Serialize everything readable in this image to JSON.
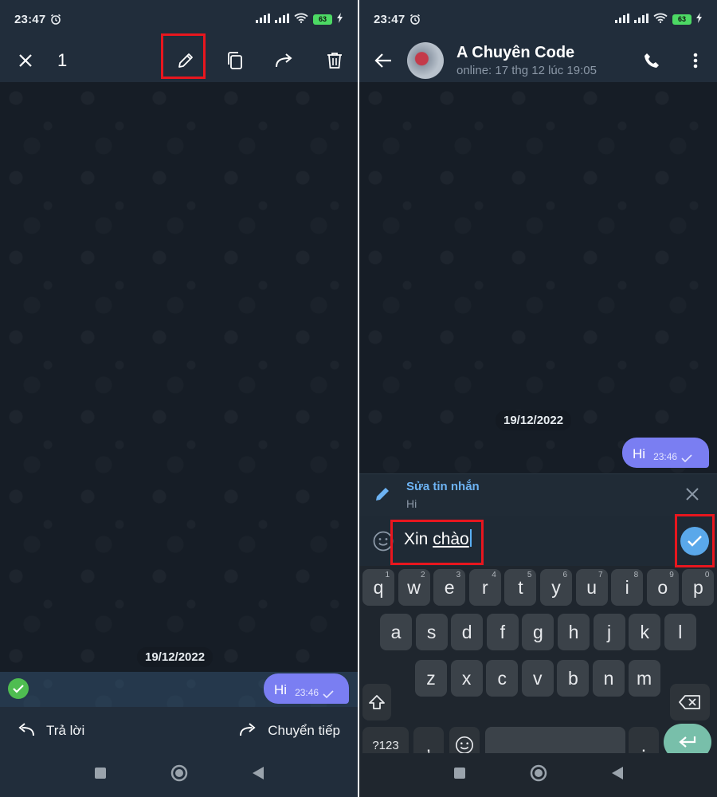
{
  "left": {
    "status": {
      "time": "23:47",
      "battery": "63"
    },
    "topbar": {
      "selected_count": "1"
    },
    "date": "19/12/2022",
    "message": {
      "text": "Hi",
      "time": "23:46"
    },
    "actions": {
      "reply": "Trả lời",
      "forward": "Chuyển tiếp"
    }
  },
  "right": {
    "status": {
      "time": "23:47",
      "battery": "63"
    },
    "header": {
      "name": "A Chuyên Code",
      "status": "online: 17 thg 12 lúc 19:05"
    },
    "date": "19/12/2022",
    "message": {
      "text": "Hi",
      "time": "23:46"
    },
    "edit": {
      "label": "Sửa tin nhắn",
      "original": "Hi"
    },
    "input": {
      "prefix": "Xin ",
      "composing": "chào"
    },
    "keyboard": {
      "row1": [
        {
          "key": "q",
          "hint": "1"
        },
        {
          "key": "w",
          "hint": "2"
        },
        {
          "key": "e",
          "hint": "3"
        },
        {
          "key": "r",
          "hint": "4"
        },
        {
          "key": "t",
          "hint": "5"
        },
        {
          "key": "y",
          "hint": "6"
        },
        {
          "key": "u",
          "hint": "7"
        },
        {
          "key": "i",
          "hint": "8"
        },
        {
          "key": "o",
          "hint": "9"
        },
        {
          "key": "p",
          "hint": "0"
        }
      ],
      "row2": [
        "a",
        "s",
        "d",
        "f",
        "g",
        "h",
        "j",
        "k",
        "l"
      ],
      "row3": [
        "z",
        "x",
        "c",
        "v",
        "b",
        "n",
        "m"
      ],
      "symbols": "?123",
      "comma": ",",
      "period": "."
    }
  },
  "colors": {
    "bubble": "#7a7ef2",
    "accent": "#5aa8ea",
    "highlight_box": "#e8161e",
    "selected_check": "#4fbd51",
    "enter_key": "#78bfaa"
  }
}
